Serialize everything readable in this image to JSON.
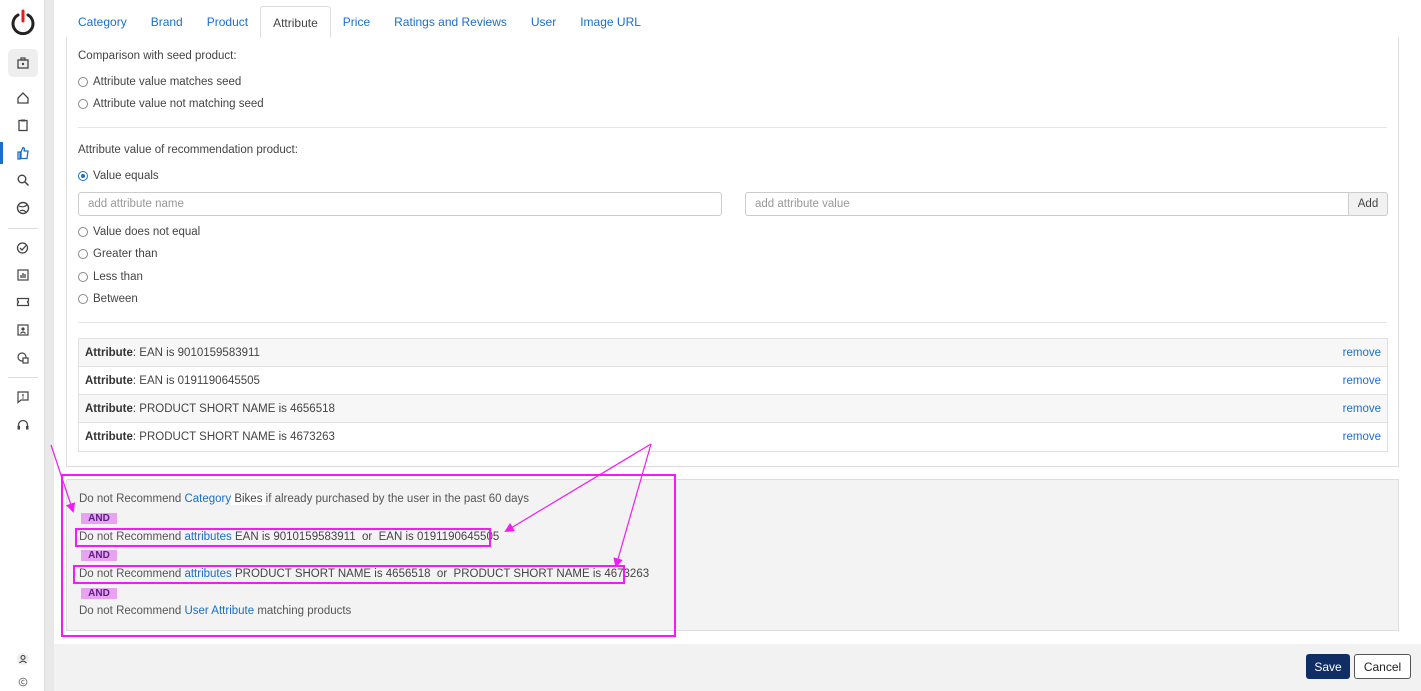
{
  "tabs": [
    {
      "label": "Category"
    },
    {
      "label": "Brand"
    },
    {
      "label": "Product"
    },
    {
      "label": "Attribute"
    },
    {
      "label": "Price"
    },
    {
      "label": "Ratings and Reviews"
    },
    {
      "label": "User"
    },
    {
      "label": "Image URL"
    }
  ],
  "active_tab": "Attribute",
  "seed": {
    "heading": "Comparison with seed product:",
    "options": [
      "Attribute value matches seed",
      "Attribute value not matching seed"
    ]
  },
  "rec": {
    "heading": "Attribute value of recommendation product:",
    "options": [
      "Value equals",
      "Value does not equal",
      "Greater than",
      "Less than",
      "Between"
    ],
    "selected": "Value equals",
    "name_placeholder": "add attribute name",
    "value_placeholder": "add attribute value",
    "add_label": "Add"
  },
  "attributes": [
    {
      "label": "Attribute",
      "text": ": EAN is 9010159583911",
      "action": "remove"
    },
    {
      "label": "Attribute",
      "text": ": EAN is 0191190645505",
      "action": "remove"
    },
    {
      "label": "Attribute",
      "text": ": PRODUCT SHORT NAME is 4656518",
      "action": "remove"
    },
    {
      "label": "Attribute",
      "text": ": PRODUCT SHORT NAME is 4673263",
      "action": "remove"
    }
  ],
  "summary": {
    "line1": {
      "prefix": "Do not Recommend ",
      "link": "Category",
      "value": " Bikes ",
      "suffix": " if already purchased by the user in the past 60 days"
    },
    "line2": {
      "prefix": "Do not Recommend ",
      "link": "attributes",
      "value": " EAN is 9010159583911  or  EAN is 0191190645505"
    },
    "line3": {
      "prefix": "Do not Recommend ",
      "link": "attributes",
      "value": " PRODUCT SHORT NAME is 4656518  or  PRODUCT SHORT NAME is 4673263"
    },
    "line4": {
      "prefix": "Do not Recommend ",
      "link": "User Attribute",
      "suffix": " matching products"
    },
    "and_label": "AND"
  },
  "footer": {
    "save": "Save",
    "cancel": "Cancel"
  },
  "colors": {
    "accent": "#1a6fc9",
    "annotation": "#f21af5",
    "save_bg": "#102e63"
  },
  "sidebar": {
    "icons": [
      "power-logo-icon",
      "briefcase-icon",
      "home-icon",
      "clipboard-icon",
      "thumbs-up-icon",
      "search-icon",
      "globe-icon",
      "check-circle-icon",
      "chart-icon",
      "ticket-icon",
      "contact-card-icon",
      "shapes-icon",
      "feedback-icon",
      "support-icon",
      "user-icon",
      "copyright-icon"
    ]
  }
}
